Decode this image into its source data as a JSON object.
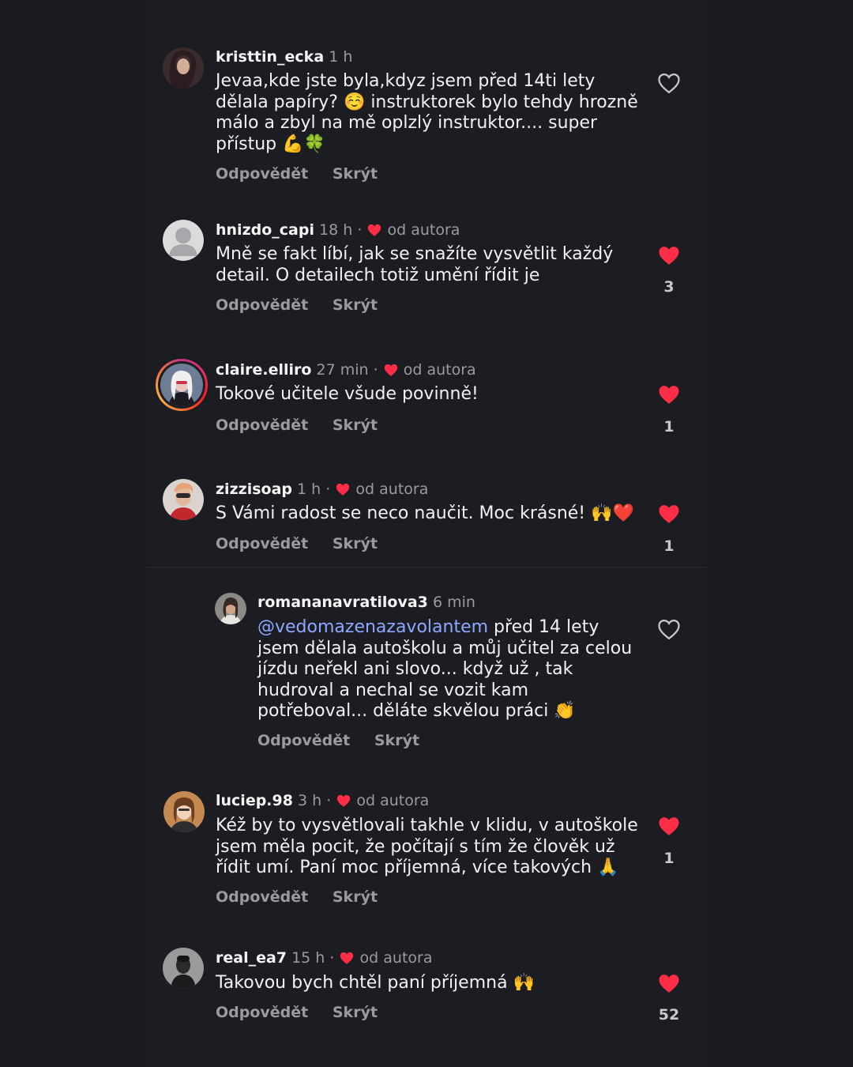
{
  "actions": {
    "reply": "Odpovědět",
    "hide": "Skrýt"
  },
  "colors": {
    "background": "#1a1b1f",
    "liked": "#ff2d45",
    "mention": "#8ea7ff",
    "muted": "#9a9a9f"
  },
  "comments": [
    {
      "username": "kristtin_ecka",
      "time": "1 h",
      "author_liked": false,
      "text": "Jevaa,kde jste byla,kdyz jsem před 14ti lety dělala papíry? ☺️ instruktorek bylo tehdy hrozně málo a zbyl na mě oplzlý instruktor.... super přístup 💪🍀",
      "liked": false,
      "likes": ""
    },
    {
      "username": "hnizdo_capi",
      "time": "18 h",
      "author_liked": true,
      "author_label": "od autora",
      "text": "Mně se fakt líbí, jak se snažíte vysvětlit každý detail. O detailech totiž umění řídit je",
      "liked": true,
      "likes": "3"
    },
    {
      "username": "claire.elliro",
      "time": "27 min",
      "author_liked": true,
      "author_label": "od autora",
      "text": "Tokové učitele všude povinně!",
      "liked": true,
      "likes": "1"
    },
    {
      "username": "zizzisoap",
      "time": "1 h",
      "author_liked": true,
      "author_label": "od autora",
      "text": "S Vámi radost se neco naučit. Moc krásné! 🙌❤️",
      "liked": true,
      "likes": "1"
    },
    {
      "username": "romananavratilova3",
      "time": "6 min",
      "author_liked": false,
      "mention": "@vedomazenazavolantem",
      "text": " před 14 lety jsem dělala autoškolu a můj učitel za celou jízdu neřekl ani slovo... když už , tak hudroval a nechal se vozit kam potřeboval... děláte skvělou práci 👏",
      "liked": false,
      "likes": ""
    },
    {
      "username": "luciep.98",
      "time": "3 h",
      "author_liked": true,
      "author_label": "od autora",
      "text": "Kéž by to vysvětlovali takhle v klidu, v autoškole jsem měla pocit, že počítají s tím že člověk už řídit umí. Paní moc příjemná, více takových 🙏",
      "liked": true,
      "likes": "1"
    },
    {
      "username": "real_ea7",
      "time": "15 h",
      "author_liked": true,
      "author_label": "od autora",
      "text": "Takovou bych chtěl paní příjemná 🙌",
      "liked": true,
      "likes": "52"
    }
  ]
}
